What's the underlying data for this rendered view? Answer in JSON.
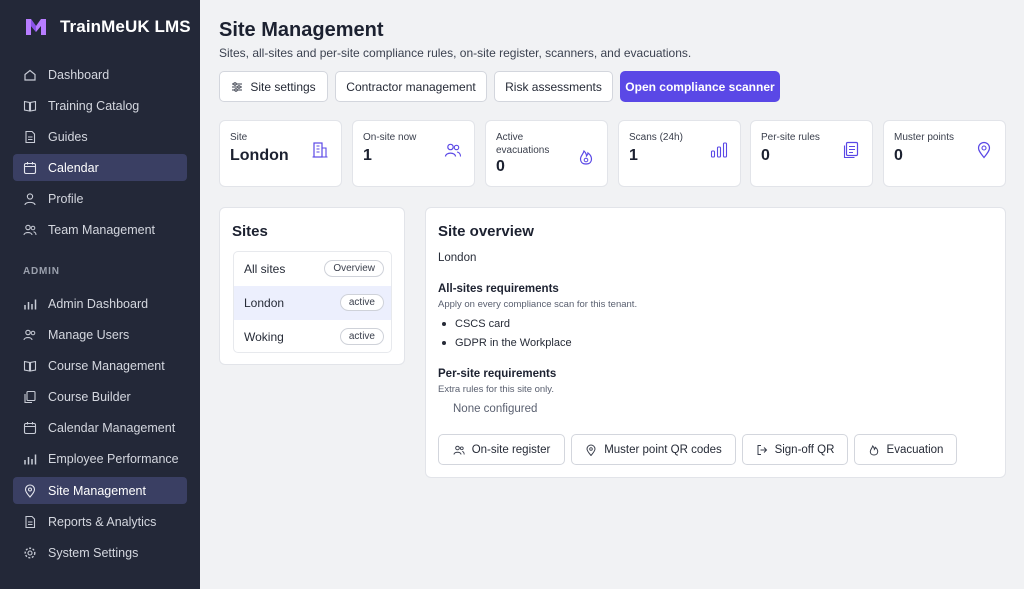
{
  "app": {
    "name": "TrainMeUK LMS",
    "brand_color": "#b77dff"
  },
  "sidebar": {
    "items": [
      {
        "label": "Dashboard",
        "icon": "home-icon"
      },
      {
        "label": "Training Catalog",
        "icon": "book-icon"
      },
      {
        "label": "Guides",
        "icon": "document-icon"
      },
      {
        "label": "Calendar",
        "icon": "calendar-icon"
      },
      {
        "label": "Profile",
        "icon": "user-icon"
      },
      {
        "label": "Team Management",
        "icon": "users-icon"
      }
    ],
    "admin_label": "ADMIN",
    "admin_items": [
      {
        "label": "Admin Dashboard",
        "icon": "bar-chart-icon"
      },
      {
        "label": "Manage Users",
        "icon": "users-icon"
      },
      {
        "label": "Course Management",
        "icon": "book-icon"
      },
      {
        "label": "Course Builder",
        "icon": "copy-icon"
      },
      {
        "label": "Calendar Management",
        "icon": "calendar-icon"
      },
      {
        "label": "Employee Performance",
        "icon": "bar-chart-icon"
      },
      {
        "label": "Site Management",
        "icon": "map-pin-icon"
      },
      {
        "label": "Reports & Analytics",
        "icon": "document-icon"
      },
      {
        "label": "System Settings",
        "icon": "gear-icon"
      }
    ]
  },
  "header": {
    "title": "Site Management",
    "subtitle": "Sites, all-sites and per-site compliance rules, on-site register, scanners, and evacuations."
  },
  "toolbar": {
    "site_settings": "Site settings",
    "contractor_management": "Contractor management",
    "risk_assessments": "Risk assessments",
    "open_scanner": "Open compliance scanner"
  },
  "stats": [
    {
      "label": "Site",
      "value": "London"
    },
    {
      "label": "On-site now",
      "value": "1"
    },
    {
      "label": "Active evacuations",
      "value": "0"
    },
    {
      "label": "Scans (24h)",
      "value": "1"
    },
    {
      "label": "Per-site rules",
      "value": "0"
    },
    {
      "label": "Muster points",
      "value": "0"
    }
  ],
  "sites": {
    "title": "Sites",
    "rows": [
      {
        "name": "All sites",
        "badge": "Overview"
      },
      {
        "name": "London",
        "badge": "active"
      },
      {
        "name": "Woking",
        "badge": "active"
      }
    ]
  },
  "overview": {
    "title": "Site overview",
    "site_name": "London",
    "all_sites_heading": "All-sites requirements",
    "all_sites_desc": "Apply on every compliance scan for this tenant.",
    "all_sites_items": [
      "CSCS card",
      "GDPR in the Workplace"
    ],
    "per_site_heading": "Per-site requirements",
    "per_site_desc": "Extra rules for this site only.",
    "per_site_empty": "None configured",
    "actions": {
      "register": "On-site register",
      "muster": "Muster point QR codes",
      "signoff": "Sign-off QR",
      "evacuation": "Evacuation"
    }
  },
  "colors": {
    "accent": "#5a48e6",
    "sidebar_bg": "#232838",
    "active_nav": "#3a3f63",
    "icon_accent": "#5a48e6"
  }
}
